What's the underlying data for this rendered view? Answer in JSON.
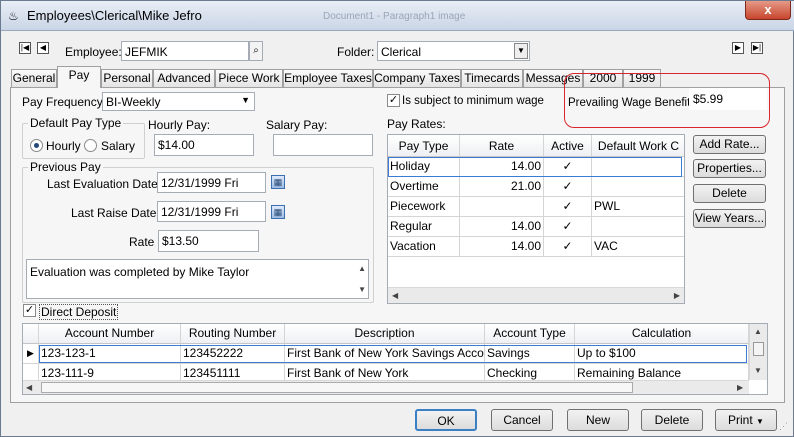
{
  "window": {
    "title": "Employees\\Clerical\\Mike Jefro",
    "ghost_title": "Document1 - Paragraph1 image",
    "close_label": "x"
  },
  "header": {
    "employee_label": "Employee:",
    "employee_value": "JEFMIK",
    "folder_label": "Folder:",
    "folder_value": "Clerical"
  },
  "tabs": [
    "General",
    "Pay",
    "Personal",
    "Advanced",
    "Piece Work",
    "Employee Taxes",
    "Company Taxes",
    "Timecards",
    "Messages",
    "2000",
    "1999"
  ],
  "active_tab": "Pay",
  "pay": {
    "pay_frequency_label": "Pay Frequency:",
    "pay_frequency_value": "BI-Weekly",
    "default_pay_type_title": "Default Pay Type",
    "hourly_label": "Hourly",
    "salary_label": "Salary",
    "hourly_pay_label": "Hourly Pay:",
    "hourly_pay_value": "$14.00",
    "salary_pay_label": "Salary Pay:",
    "salary_pay_value": "",
    "previous_pay_title": "Previous Pay",
    "last_eval_label": "Last Evaluation Date:",
    "last_eval_value": "12/31/1999 Fri",
    "last_raise_label": "Last Raise Date:",
    "last_raise_value": "12/31/1999 Fri",
    "rate_label": "Rate",
    "rate_value": "$13.50",
    "notes": "Evaluation was completed by Mike Taylor",
    "min_wage_label": "Is subject to minimum wage",
    "prevailing_wage_label": "Prevailing Wage Benefit:",
    "prevailing_wage_value": "$5.99",
    "pay_rates_label": "Pay Rates:"
  },
  "pay_rates": {
    "columns": [
      "Pay Type",
      "Rate",
      "Active",
      "Default Work C"
    ],
    "rows": [
      {
        "type": "Holiday",
        "rate": "14.00",
        "active": "✓",
        "work": ""
      },
      {
        "type": "Overtime",
        "rate": "21.00",
        "active": "✓",
        "work": ""
      },
      {
        "type": "Piecework",
        "rate": "",
        "active": "✓",
        "work": "PWL"
      },
      {
        "type": "Regular",
        "rate": "14.00",
        "active": "✓",
        "work": ""
      },
      {
        "type": "Vacation",
        "rate": "14.00",
        "active": "✓",
        "work": "VAC"
      }
    ]
  },
  "rate_buttons": {
    "add_rate": "Add Rate...",
    "properties": "Properties...",
    "delete": "Delete",
    "view_years": "View Years..."
  },
  "direct_deposit": {
    "label": "Direct Deposit",
    "columns": [
      "Account Number",
      "Routing Number",
      "Description",
      "Account Type",
      "Calculation"
    ],
    "rows": [
      {
        "account": "123-123-1",
        "routing": "123452222",
        "description": "First Bank of New York Savings Account",
        "type": "Savings",
        "calc": "Up to $100"
      },
      {
        "account": "123-111-9",
        "routing": "123451111",
        "description": "First Bank of New York",
        "type": "Checking",
        "calc": "Remaining Balance"
      }
    ]
  },
  "footer": {
    "ok": "OK",
    "cancel": "Cancel",
    "new": "New",
    "delete": "Delete",
    "print": "Print"
  },
  "colors": {
    "highlight_circle": "#d9262e",
    "selection_border": "#3a7bd5"
  }
}
